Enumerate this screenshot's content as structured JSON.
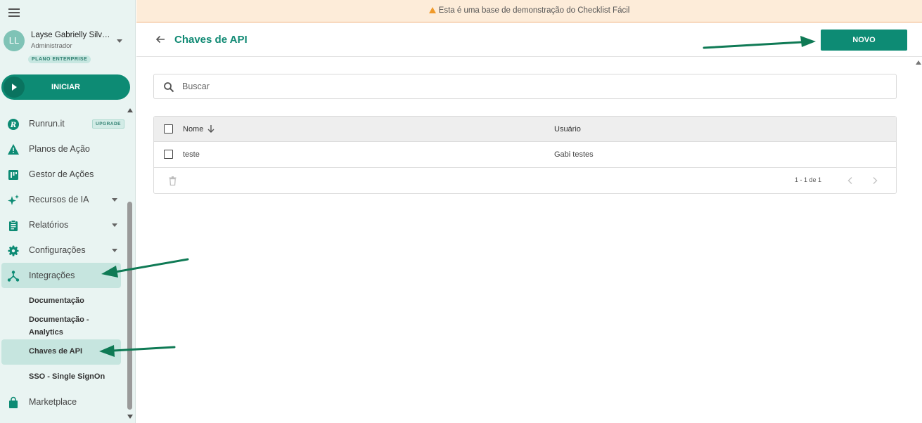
{
  "sidebar": {
    "user": {
      "initials": "LL",
      "name": "Layse Gabrielly Silva ...",
      "role": "Administrador",
      "plan": "PLANO ENTERPRISE"
    },
    "start_label": "INICIAR",
    "items": [
      {
        "label": "Runrun.it",
        "icon": "runrunit-logo-icon",
        "badge": "UPGRADE"
      },
      {
        "label": "Planos de Ação",
        "icon": "warning-triangle-icon"
      },
      {
        "label": "Gestor de Ações",
        "icon": "kanban-board-icon"
      },
      {
        "label": "Recursos de IA",
        "icon": "sparkle-icon",
        "expandable": true
      },
      {
        "label": "Relatórios",
        "icon": "clipboard-icon",
        "expandable": true
      },
      {
        "label": "Configurações",
        "icon": "gear-icon",
        "expandable": true
      },
      {
        "label": "Integrações",
        "icon": "integration-hub-icon",
        "active": true
      },
      {
        "label": "Marketplace",
        "icon": "shopping-bag-icon"
      }
    ],
    "sub_items": [
      {
        "label": "Documentação"
      },
      {
        "label": "Documentação - Analytics"
      },
      {
        "label": "Chaves de API",
        "active": true
      },
      {
        "label": "SSO - Single SignOn"
      }
    ]
  },
  "banner": {
    "text": "Esta é uma base de demonstração do Checklist Fácil"
  },
  "header": {
    "title": "Chaves de API",
    "new_button": "NOVO"
  },
  "search": {
    "placeholder": "Buscar",
    "value": ""
  },
  "table": {
    "columns": [
      "Nome",
      "Usuário"
    ],
    "rows": [
      {
        "nome": "teste",
        "usuario": "Gabi testes"
      }
    ],
    "pagination": "1 - 1 de 1"
  },
  "colors": {
    "accent": "#0d8b74",
    "title": "#118a74",
    "sidebar_bg": "#e9f4f2",
    "active_bg": "#c6e5df",
    "banner_bg": "#fdecd9",
    "annotation_arrow": "#0f7a55"
  }
}
